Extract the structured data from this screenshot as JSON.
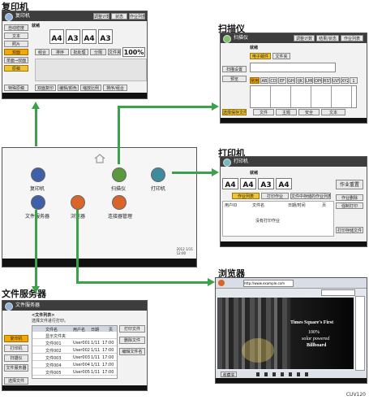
{
  "labels": {
    "copier": "复印机",
    "scanner": "扫描仪",
    "printer": "打印机",
    "browser": "浏览器",
    "docserver": "文件服务器",
    "figure_code": "CUV120"
  },
  "home": {
    "apps": [
      {
        "name": "复印机",
        "color": "#3f5fa8"
      },
      {
        "name": "扫描仪",
        "color": "#5a9a3c"
      },
      {
        "name": "打印机",
        "color": "#3f8a9c"
      },
      {
        "name": "文件服务器",
        "color": "#3f5fa8"
      },
      {
        "name": "浏览器",
        "color": "#d9652b"
      },
      {
        "name": "连接器管理",
        "color": "#d9652b"
      }
    ],
    "status_line": "2012 1/11\n12:00"
  },
  "copier_screen": {
    "title": "复印机",
    "status": "就绪",
    "top_buttons": [
      "调整计数",
      "状态",
      "作业列表"
    ],
    "paper_sizes": [
      "A4",
      "A3",
      "A4",
      "A3"
    ],
    "paper_prefix": [
      "1",
      "2",
      "3",
      "T"
    ],
    "zoom": "100%",
    "left_buttons": [
      "自动密度",
      "文本",
      "照片",
      "双面",
      "单面→双面",
      "原稿"
    ],
    "bottom_buttons": [
      "特殊原稿",
      "双面复印",
      "编辑/颜色",
      "缩放比例",
      "排序/组合"
    ],
    "mid_buttons": [
      "组合",
      "排序",
      "批处理",
      "分隔",
      "文件夹"
    ]
  },
  "scanner_screen": {
    "title": "扫描仪",
    "status": "就绪",
    "top_buttons": [
      "调整计数",
      "结果/状态",
      "作业列表"
    ],
    "tabs": [
      "电子邮件",
      "文件夹"
    ],
    "toolbar": [
      "扫描设置",
      "预览"
    ],
    "alphabet": [
      "常用",
      "AB",
      "CD",
      "EF",
      "GH",
      "IJK",
      "LMN",
      "OPQ",
      "RST",
      "UVW",
      "XYZ",
      "1"
    ],
    "bottom_buttons": [
      "选择保存文件",
      "文件",
      "主题",
      "安全",
      "文本"
    ]
  },
  "printer_screen": {
    "title": "打印机",
    "status": "就绪",
    "paper_sizes": [
      "A4",
      "A4",
      "A3",
      "A4"
    ],
    "paper_prefix": [
      "1",
      "2",
      "3",
      "T"
    ],
    "tabs": [
      "作业列表",
      "打印作业",
      "文件中存储的作业列表"
    ],
    "columns": [
      "用户ID",
      "文件名",
      "日期/时间",
      "页"
    ],
    "empty_text": "没有打印作业",
    "right_buttons": [
      "作业重置",
      "作业删除",
      "强制打印",
      "打印存储文件"
    ],
    "stop_button": "作业重置"
  },
  "browser_screen": {
    "title": "浏览器",
    "url": "http://www.example.com",
    "banner_line1": "Times Square's First",
    "banner_line2": "100%",
    "banner_line3": "solar powered",
    "banner_line4": "Billboard",
    "bottom_buttons": [
      "收藏夹"
    ]
  },
  "docserver_screen": {
    "title": "文件服务器",
    "header_line1": "<文件列表>",
    "header_line2": "选择文件进行打印。",
    "columns": [
      "文件名",
      "用户名",
      "日期",
      "页"
    ],
    "rows": [
      {
        "name": "显示文件夹",
        "user": "",
        "date": "",
        "time": ""
      },
      {
        "name": "文件001",
        "user": "User001",
        "date": "1/11",
        "time": "17:00"
      },
      {
        "name": "文件002",
        "user": "User002",
        "date": "1/11",
        "time": "17:00"
      },
      {
        "name": "文件003",
        "user": "User003",
        "date": "1/11",
        "time": "17:00"
      },
      {
        "name": "文件004",
        "user": "User004",
        "date": "1/11",
        "time": "17:00"
      },
      {
        "name": "文件005",
        "user": "User005",
        "date": "1/11",
        "time": "17:00"
      }
    ],
    "left_buttons": [
      "复印机",
      "打印机",
      "扫描仪",
      "文件服务器"
    ],
    "right_buttons": [
      "打印文件",
      "删除文件",
      "编辑文件名"
    ],
    "bottom_button": "选择文件"
  }
}
